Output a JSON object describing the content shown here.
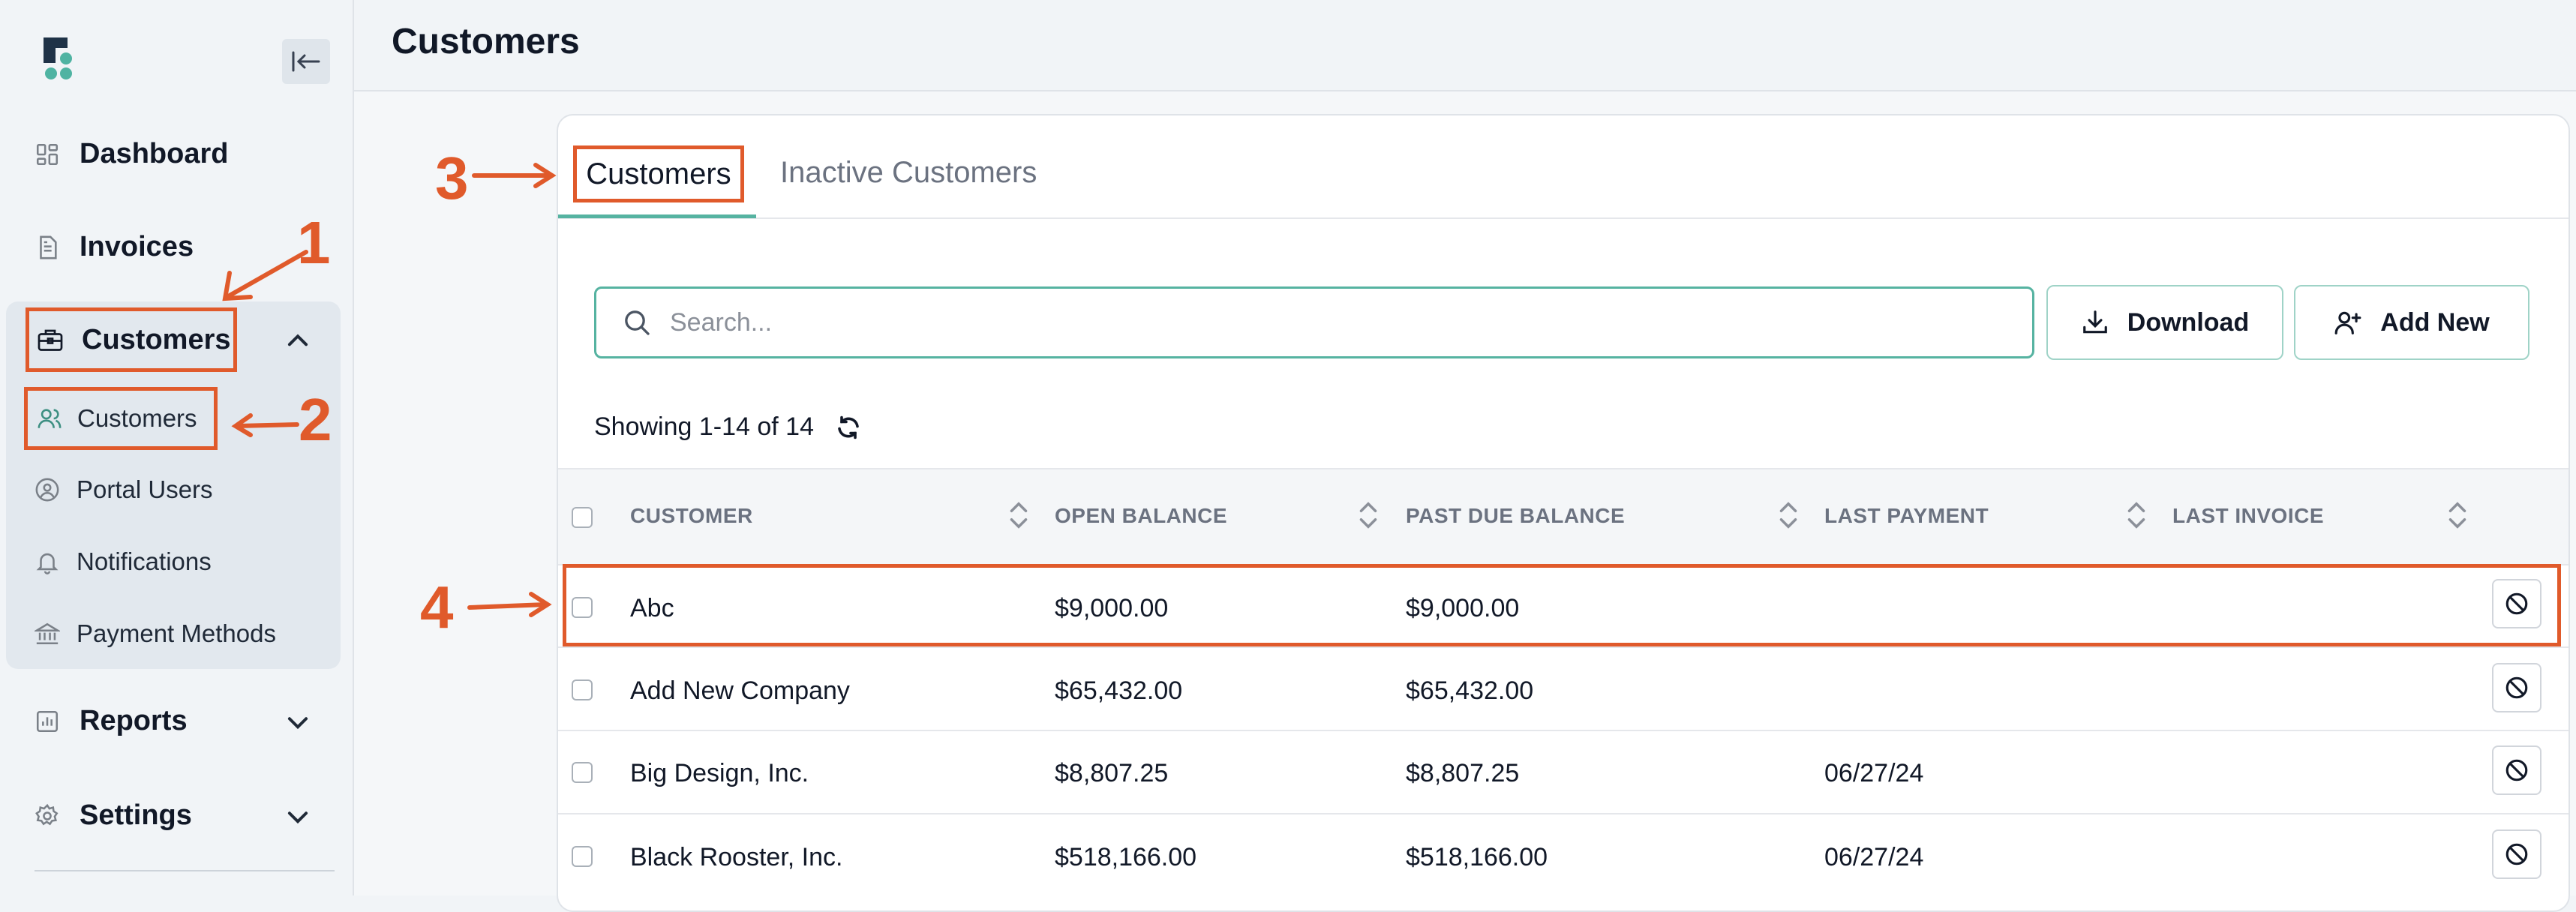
{
  "sidebar": {
    "nav": [
      {
        "label": "Dashboard",
        "icon": "dashboard-icon"
      },
      {
        "label": "Invoices",
        "icon": "invoice-icon"
      },
      {
        "label": "Customers",
        "icon": "briefcase-icon"
      },
      {
        "label": "Reports",
        "icon": "reports-icon"
      },
      {
        "label": "Settings",
        "icon": "gear-icon"
      }
    ],
    "customers_sub": [
      {
        "label": "Customers",
        "icon": "users-icon"
      },
      {
        "label": "Portal Users",
        "icon": "user-circle-icon"
      },
      {
        "label": "Notifications",
        "icon": "bell-icon"
      },
      {
        "label": "Payment Methods",
        "icon": "bank-icon"
      }
    ]
  },
  "header": {
    "title": "Customers"
  },
  "tabs": [
    {
      "label": "Customers"
    },
    {
      "label": "Inactive Customers"
    }
  ],
  "search": {
    "placeholder": "Search..."
  },
  "toolbar": {
    "download_label": "Download",
    "add_new_label": "Add New"
  },
  "showing": "Showing 1-14 of 14",
  "table": {
    "columns": [
      "CUSTOMER",
      "OPEN BALANCE",
      "PAST DUE BALANCE",
      "LAST PAYMENT",
      "LAST INVOICE"
    ],
    "rows": [
      {
        "customer": "Abc",
        "open_balance": "$9,000.00",
        "past_due": "$9,000.00",
        "last_payment": "",
        "last_invoice": ""
      },
      {
        "customer": "Add New Company",
        "open_balance": "$65,432.00",
        "past_due": "$65,432.00",
        "last_payment": "",
        "last_invoice": ""
      },
      {
        "customer": "Big Design, Inc.",
        "open_balance": "$8,807.25",
        "past_due": "$8,807.25",
        "last_payment": "06/27/24",
        "last_invoice": ""
      },
      {
        "customer": "Black Rooster, Inc.",
        "open_balance": "$518,166.00",
        "past_due": "$518,166.00",
        "last_payment": "06/27/24",
        "last_invoice": ""
      }
    ]
  },
  "annotations": [
    "1",
    "2",
    "3",
    "4"
  ],
  "colors": {
    "accent": "#56b3a1",
    "annotation": "#e05a2b"
  }
}
